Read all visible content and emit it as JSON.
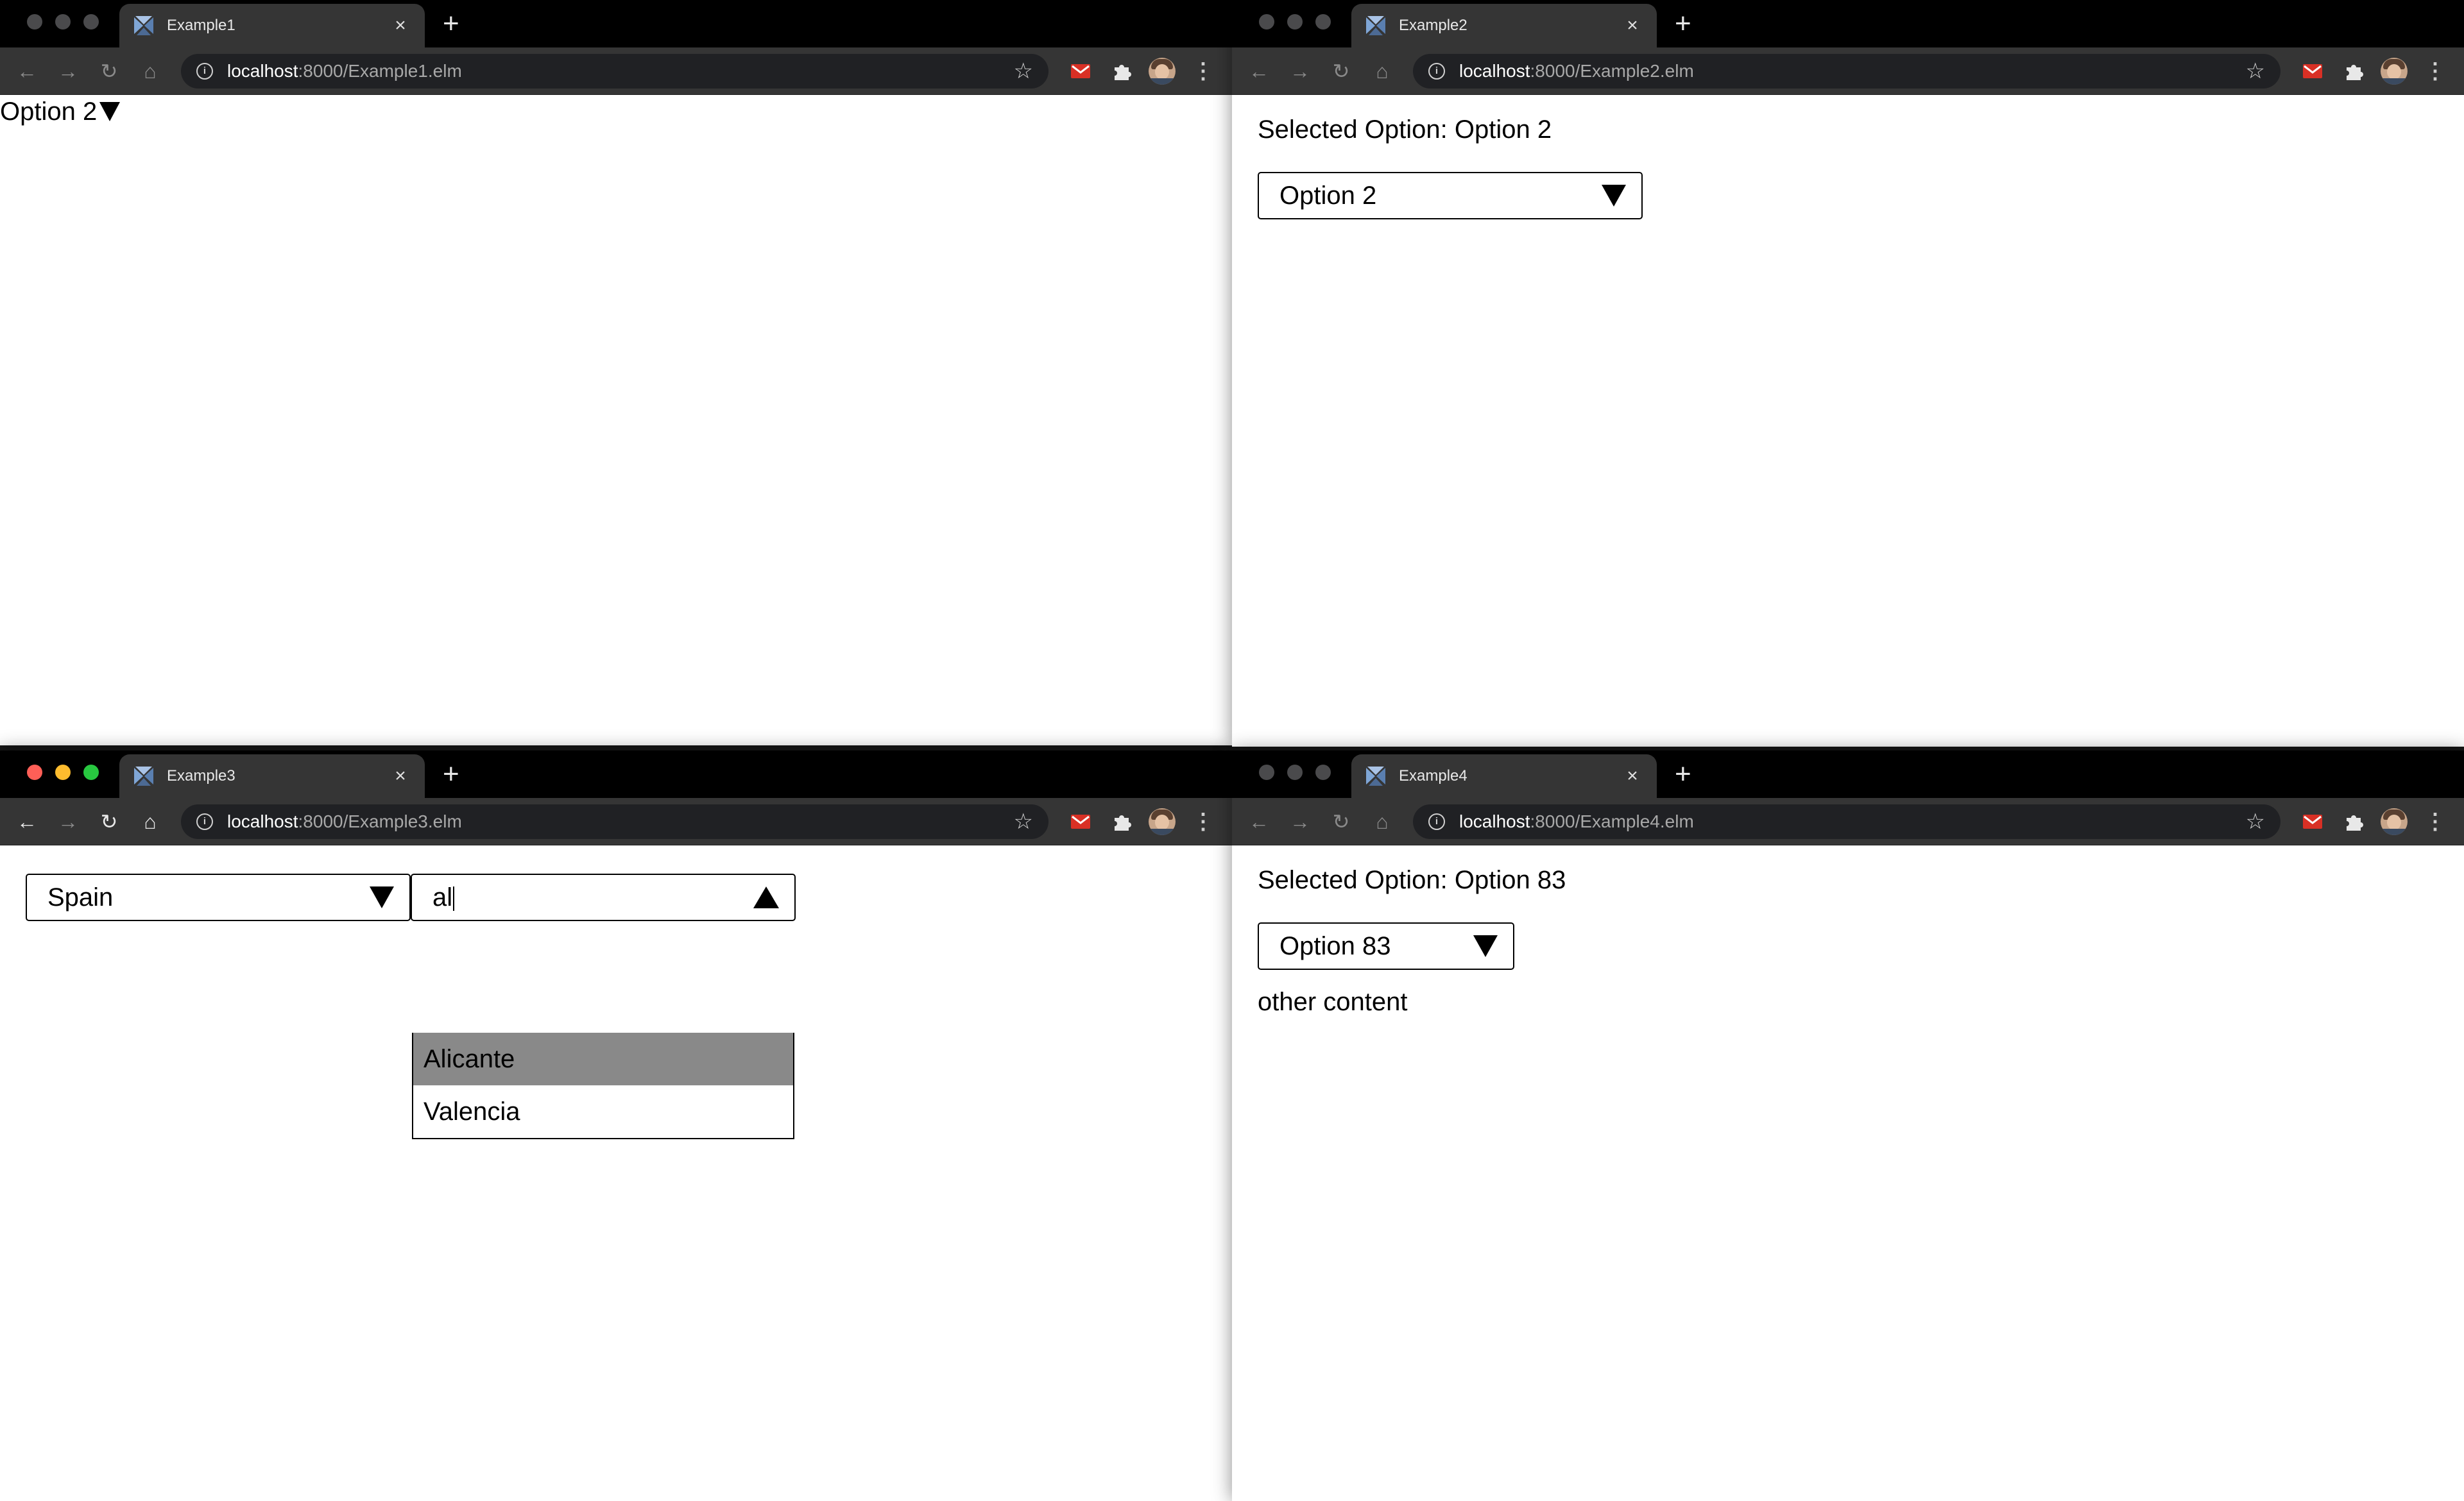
{
  "windows": {
    "tl": {
      "tab_title": "Example1",
      "url_host": "localhost",
      "url_path": ":8000/Example1.elm",
      "dropdown_value": "Option 2"
    },
    "tr": {
      "tab_title": "Example2",
      "url_host": "localhost",
      "url_path": ":8000/Example2.elm",
      "selected_label": "Selected Option: Option 2",
      "dropdown_value": "Option 2"
    },
    "bl": {
      "tab_title": "Example3",
      "url_host": "localhost",
      "url_path": ":8000/Example3.elm",
      "country_value": "Spain",
      "city_query": "al",
      "city_options": [
        "Alicante",
        "Valencia"
      ],
      "highlighted_option": "Alicante"
    },
    "br": {
      "tab_title": "Example4",
      "url_host": "localhost",
      "url_path": ":8000/Example4.elm",
      "selected_label": "Selected Option: Option 83",
      "dropdown_value": "Option 83",
      "other_content": "other content"
    }
  },
  "icons": {
    "tab_close": "×",
    "new_tab": "+",
    "back": "←",
    "forward": "→",
    "reload": "↻",
    "home": "⌂",
    "star": "☆",
    "menu": "⋮",
    "info": "i"
  },
  "colors": {
    "tab_bar": "#000000",
    "toolbar": "#353535",
    "omnibox": "#202124",
    "highlight": "#898989",
    "traffic_red": "#ff5f57",
    "traffic_yellow": "#febc2e",
    "traffic_green": "#28c840"
  }
}
